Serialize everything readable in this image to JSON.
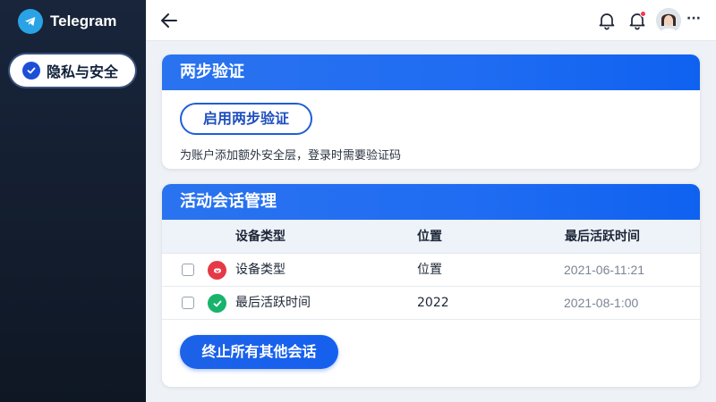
{
  "app": {
    "name": "Telegram",
    "accent": "#1f6cf2",
    "sidebar_bg": "#131d2e"
  },
  "sidebar": {
    "items": [
      {
        "label": "隐私与安全",
        "icon": "check-circle-icon",
        "active": true
      }
    ]
  },
  "topbar": {
    "icons": [
      "back-arrow-icon",
      "bell-icon",
      "bell-notification-icon",
      "avatar",
      "more-icon"
    ],
    "more_label": "···"
  },
  "two_step": {
    "title": "两步验证",
    "button_label": "启用两步验证",
    "description": "为账户添加额外安全层，登录时需要验证码"
  },
  "sessions": {
    "title": "活动会话管理",
    "columns": [
      "设备类型",
      "位置",
      "最后活跃时间"
    ],
    "rows": [
      {
        "status": "warning",
        "status_color": "#e53946",
        "device": "设备类型",
        "location": "位置",
        "last_active": "2021-06-11:21"
      },
      {
        "status": "ok",
        "status_color": "#19b36b",
        "device": "最后活跃时间",
        "location": "2022",
        "last_active": "2021-08-1:00"
      }
    ],
    "terminate_label": "终止所有其他会话"
  }
}
